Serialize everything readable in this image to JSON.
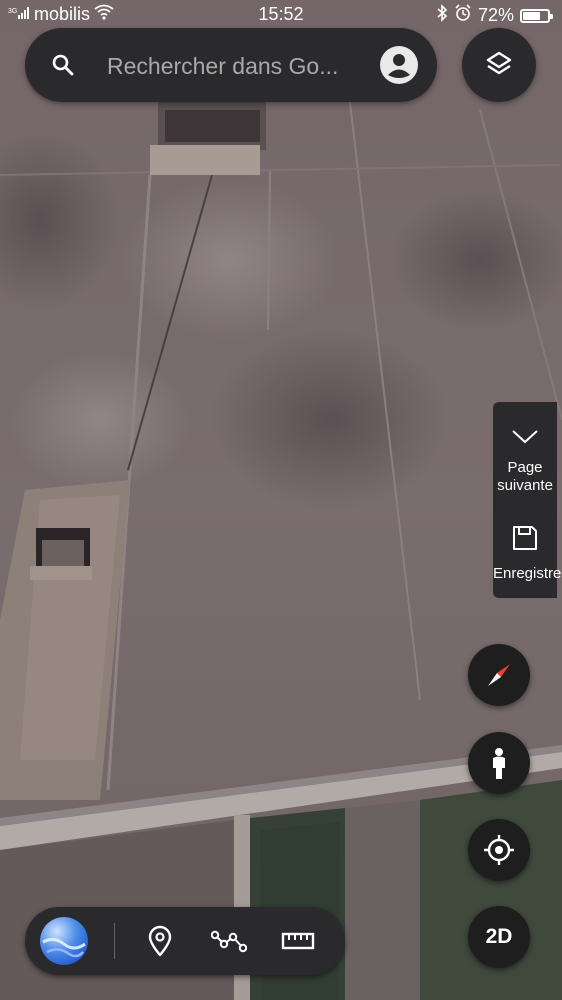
{
  "status_bar": {
    "network": "3G",
    "carrier": "mobilis",
    "time": "15:52",
    "battery": "72%",
    "battery_level": 0.72
  },
  "search": {
    "placeholder": "Rechercher dans Go...",
    "icon": "search-icon",
    "account_icon": "account-circle-icon"
  },
  "layers_button": {
    "icon": "layers-icon"
  },
  "side_panel": {
    "next_label": "Page suivante",
    "next_icon": "chevron-down-icon",
    "save_label": "Enregistrer",
    "save_icon": "save-icon"
  },
  "controls": {
    "compass_icon": "compass-icon",
    "street_view_icon": "pegman-icon",
    "locate_icon": "my-location-icon",
    "view_mode_label": "2D"
  },
  "toolbar": {
    "globe_icon": "earth-globe-icon",
    "pin_icon": "place-pin-icon",
    "path_icon": "draw-path-icon",
    "ruler_icon": "ruler-icon"
  },
  "colors": {
    "panel": "#2a2a2c",
    "fab": "#1e1e1f",
    "compass_red": "#e84135"
  }
}
